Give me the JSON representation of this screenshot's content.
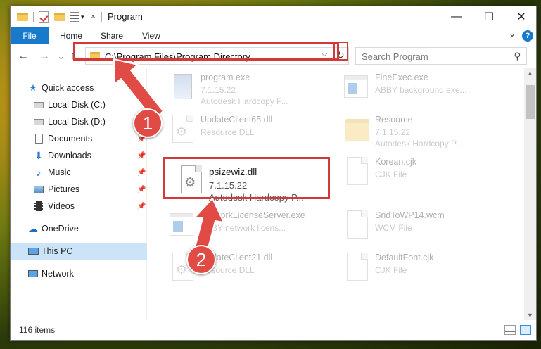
{
  "window": {
    "title": "Program",
    "controls": {
      "minimize": "—",
      "maximize": "☐",
      "close": "✕"
    }
  },
  "ribbon": {
    "tabs": [
      "File",
      "Home",
      "Share",
      "View"
    ],
    "help": "?"
  },
  "address": {
    "path": "C:\\Program Files\\Program Directory",
    "dropdown": "⌵",
    "refresh": "↻"
  },
  "search": {
    "placeholder": "Search Program",
    "icon": "search-icon"
  },
  "nav": {
    "back": "←",
    "forward": "→",
    "recent": "⌄",
    "up": "↑"
  },
  "sidebar": {
    "items": [
      {
        "label": "Quick access",
        "icon": "star-icon"
      },
      {
        "label": "Local Disk (C:)",
        "icon": "drive-icon"
      },
      {
        "label": "Local Disk (D:)",
        "icon": "drive-icon"
      },
      {
        "label": "Documents",
        "icon": "documents-icon"
      },
      {
        "label": "Downloads",
        "icon": "downloads-icon"
      },
      {
        "label": "Music",
        "icon": "music-icon"
      },
      {
        "label": "Pictures",
        "icon": "pictures-icon"
      },
      {
        "label": "Videos",
        "icon": "videos-icon"
      },
      {
        "label": "OneDrive",
        "icon": "onedrive-icon"
      },
      {
        "label": "This PC",
        "icon": "computer-icon"
      },
      {
        "label": "Network",
        "icon": "network-icon"
      }
    ]
  },
  "files": [
    {
      "name": "program.exe",
      "line1": "7.1.15.22",
      "line2": "Autodesk Hardcopy P...",
      "icon": "exe-icon"
    },
    {
      "name": "FineExec.exe",
      "line1": "ABBY background exe...",
      "line2": "",
      "icon": "app-icon"
    },
    {
      "name": "UpdateClient65.dll",
      "line1": "Resource DLL",
      "line2": "",
      "icon": "dll-icon"
    },
    {
      "name": "Resource",
      "line1": "7.1.15.22",
      "line2": "Autodesk Hardcopy P...",
      "icon": "folder-icon"
    },
    {
      "name": "psizewiz.dll",
      "line1": "7.1.15.22",
      "line2": "Autodesk Hardcopy P...",
      "icon": "dll-icon"
    },
    {
      "name": "Korean.cjk",
      "line1": "CJK File",
      "line2": "",
      "icon": "file-icon"
    },
    {
      "name": "NetworkLicenseServer.exe",
      "line1": "ABBY network licens...",
      "line2": "",
      "icon": "app-icon"
    },
    {
      "name": "SndToWP14.wcm",
      "line1": "WCM File",
      "line2": "",
      "icon": "file-icon"
    },
    {
      "name": "UpdateClient21.dll",
      "line1": "Resource DLL",
      "line2": "",
      "icon": "dll-icon"
    },
    {
      "name": "DefaultFont.cjk",
      "line1": "CJK File",
      "line2": "",
      "icon": "file-icon"
    }
  ],
  "status": {
    "count": "116 items"
  },
  "annotations": {
    "badge1": "1",
    "badge2": "2",
    "accent": "#d23a3a"
  }
}
